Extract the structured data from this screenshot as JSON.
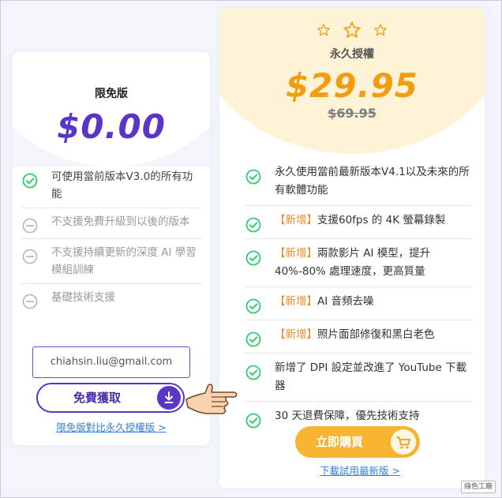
{
  "free_plan": {
    "title": "限免版",
    "price": "$0.00",
    "features": [
      {
        "text": "可使用當前版本V3.0的所有功能",
        "status": "check"
      },
      {
        "text": "不支援免費升級到以後的版本",
        "status": "minus"
      },
      {
        "text": "不支援持續更新的深度 AI 學習模組訓練",
        "status": "minus"
      },
      {
        "text": "基礎技術支援",
        "status": "minus"
      }
    ],
    "email_value": "chiahsin.liu@gmail.com",
    "button_label": "免費獲取",
    "button_icon": "download-icon",
    "compare_link": "限免版對比永久授權版 >"
  },
  "pro_plan": {
    "title": "永久授權",
    "price": "$29.95",
    "old_price": "$69.95",
    "features": [
      {
        "tag": "",
        "text": "永久使用當前最新版本V4.1以及未來的所有軟體功能"
      },
      {
        "tag": "【新增】",
        "text": "支援60fps 的 4K 螢幕錄製"
      },
      {
        "tag": "【新增】",
        "text": "兩款影片 AI 模型，提升 40%-80% 處理速度，更高質量"
      },
      {
        "tag": "【新增】",
        "text": "AI 音頻去噪"
      },
      {
        "tag": "【新增】",
        "text": "照片面部修復和黑白老色"
      },
      {
        "tag": "",
        "text": "新增了 DPI 設定並改進了 YouTube 下載器"
      },
      {
        "tag": "",
        "text": "30 天退費保障，優先技術支持"
      }
    ],
    "button_label": "立即購買",
    "button_icon": "cart-icon",
    "trial_link": "下載試用最新版 >"
  },
  "watermark": "綠色工廠",
  "colors": {
    "free_accent": "#5b35c8",
    "pro_accent": "#f39c12",
    "check_green": "#2ecc71",
    "link_blue": "#2f7fe0"
  }
}
